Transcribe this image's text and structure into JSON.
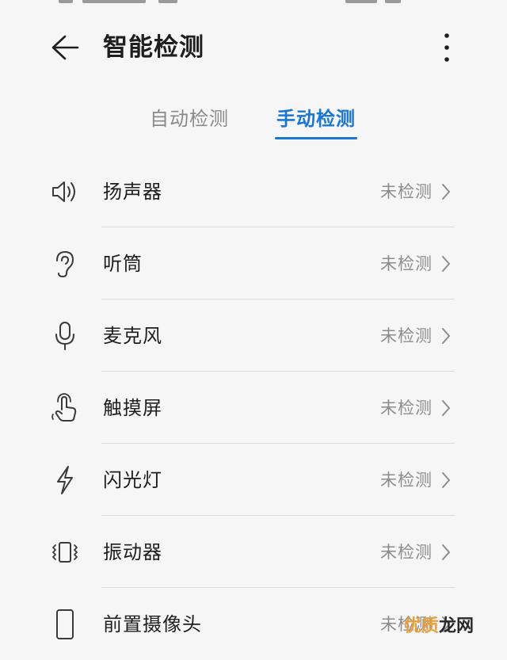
{
  "header": {
    "title": "智能检测",
    "back_icon": "arrow-left-icon",
    "more_icon": "more-vertical-icon"
  },
  "tabs": [
    {
      "label": "自动检测",
      "active": false
    },
    {
      "label": "手动检测",
      "active": true
    }
  ],
  "colors": {
    "accent": "#1976d2",
    "text_primary": "#1e1e1e",
    "text_secondary": "#8c8c8c",
    "background": "#f6f6f6",
    "divider": "#dcdcdc"
  },
  "items": [
    {
      "label": "扬声器",
      "status": "未检测",
      "icon": "speaker-icon"
    },
    {
      "label": "听筒",
      "status": "未检测",
      "icon": "ear-icon"
    },
    {
      "label": "麦克风",
      "status": "未检测",
      "icon": "microphone-icon"
    },
    {
      "label": "触摸屏",
      "status": "未检测",
      "icon": "touch-hand-icon"
    },
    {
      "label": "闪光灯",
      "status": "未检测",
      "icon": "flash-icon"
    },
    {
      "label": "振动器",
      "status": "未检测",
      "icon": "vibration-icon"
    },
    {
      "label": "前置摄像头",
      "status": "未检测",
      "icon": "phone-icon"
    }
  ],
  "watermark": {
    "part1": "优质",
    "part2": "龙网"
  }
}
